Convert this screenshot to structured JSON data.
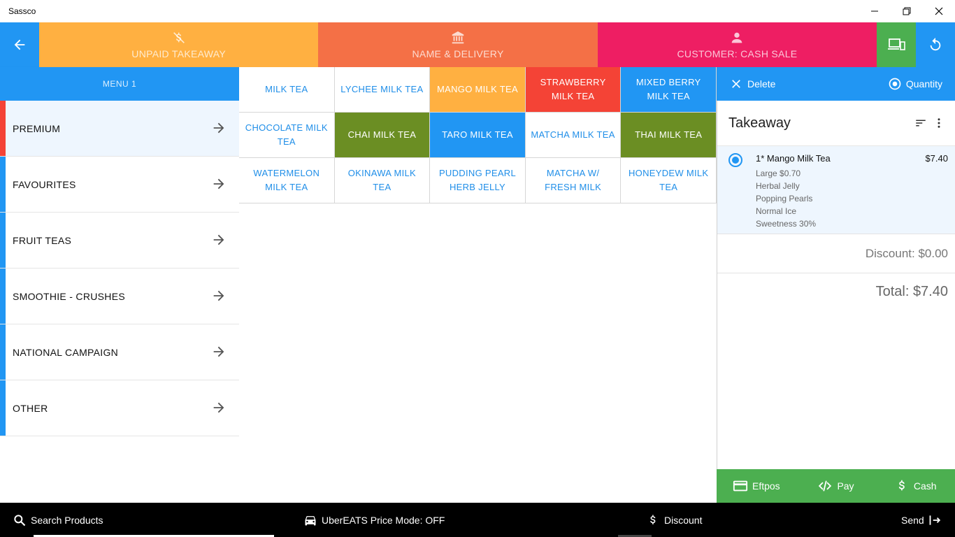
{
  "window": {
    "title": "Sassco"
  },
  "header": {
    "tabs": [
      {
        "label": "UNPAID TAKEAWAY",
        "icon": "dollar-strike-icon",
        "color": "#ffb041"
      },
      {
        "label": "NAME & DELIVERY",
        "icon": "bank-icon",
        "color": "#f47046"
      },
      {
        "label": "CUSTOMER: CASH SALE",
        "icon": "person-icon",
        "color": "#ee1e63"
      }
    ],
    "colors": {
      "back": "#2196f3",
      "devices": "#4caf50",
      "refresh": "#2196f3"
    }
  },
  "sidebar": {
    "menu_label": "MENU 1",
    "categories": [
      {
        "label": "PREMIUM"
      },
      {
        "label": "FAVOURITES"
      },
      {
        "label": "FRUIT TEAS"
      },
      {
        "label": "SMOOTHIE - CRUSHES"
      },
      {
        "label": "NATIONAL CAMPAIGN"
      },
      {
        "label": "OTHER"
      }
    ]
  },
  "products": [
    {
      "label": "MILK TEA",
      "bg": "#ffffff",
      "fg": "#1f8ee8"
    },
    {
      "label": "LYCHEE MILK TEA",
      "bg": "#ffffff",
      "fg": "#1f8ee8"
    },
    {
      "label": "MANGO MILK TEA",
      "bg": "#ffb041",
      "fg": "#ffffff"
    },
    {
      "label": "STRAWBERRY MILK TEA",
      "bg": "#f44336",
      "fg": "#ffffff"
    },
    {
      "label": "MIXED BERRY MILK TEA",
      "bg": "#2196f3",
      "fg": "#ffffff"
    },
    {
      "label": "CHOCOLATE MILK TEA",
      "bg": "#ffffff",
      "fg": "#1f8ee8"
    },
    {
      "label": "CHAI MILK TEA",
      "bg": "#6b8e23",
      "fg": "#ffffff"
    },
    {
      "label": "TARO MILK TEA",
      "bg": "#2196f3",
      "fg": "#ffffff"
    },
    {
      "label": "MATCHA MILK TEA",
      "bg": "#ffffff",
      "fg": "#1f8ee8"
    },
    {
      "label": "THAI MILK TEA",
      "bg": "#6b8e23",
      "fg": "#ffffff"
    },
    {
      "label": "WATERMELON MILK TEA",
      "bg": "#ffffff",
      "fg": "#1f8ee8"
    },
    {
      "label": "OKINAWA MILK TEA",
      "bg": "#ffffff",
      "fg": "#1f8ee8"
    },
    {
      "label": "PUDDING PEARL HERB JELLY",
      "bg": "#ffffff",
      "fg": "#1f8ee8"
    },
    {
      "label": "MATCHA W/ FRESH MILK",
      "bg": "#ffffff",
      "fg": "#1f8ee8"
    },
    {
      "label": "HONEYDEW MILK TEA",
      "bg": "#ffffff",
      "fg": "#1f8ee8"
    }
  ],
  "order": {
    "delete_label": "Delete",
    "quantity_label": "Quantity",
    "title": "Takeaway",
    "items": [
      {
        "name": "1* Mango Milk Tea",
        "price": "$7.40",
        "modifiers": [
          "Large $0.70",
          "Herbal Jelly",
          "Popping Pearls",
          "Normal Ice",
          "Sweetness 30%"
        ]
      }
    ],
    "discount": "Discount: $0.00",
    "total": "Total: $7.40"
  },
  "payment": {
    "eftpos": "Eftpos",
    "pay": "Pay",
    "cash": "Cash"
  },
  "bottom": {
    "search": "Search Products",
    "uber": "UberEATS Price Mode: OFF",
    "discount": "Discount",
    "send": "Send"
  }
}
